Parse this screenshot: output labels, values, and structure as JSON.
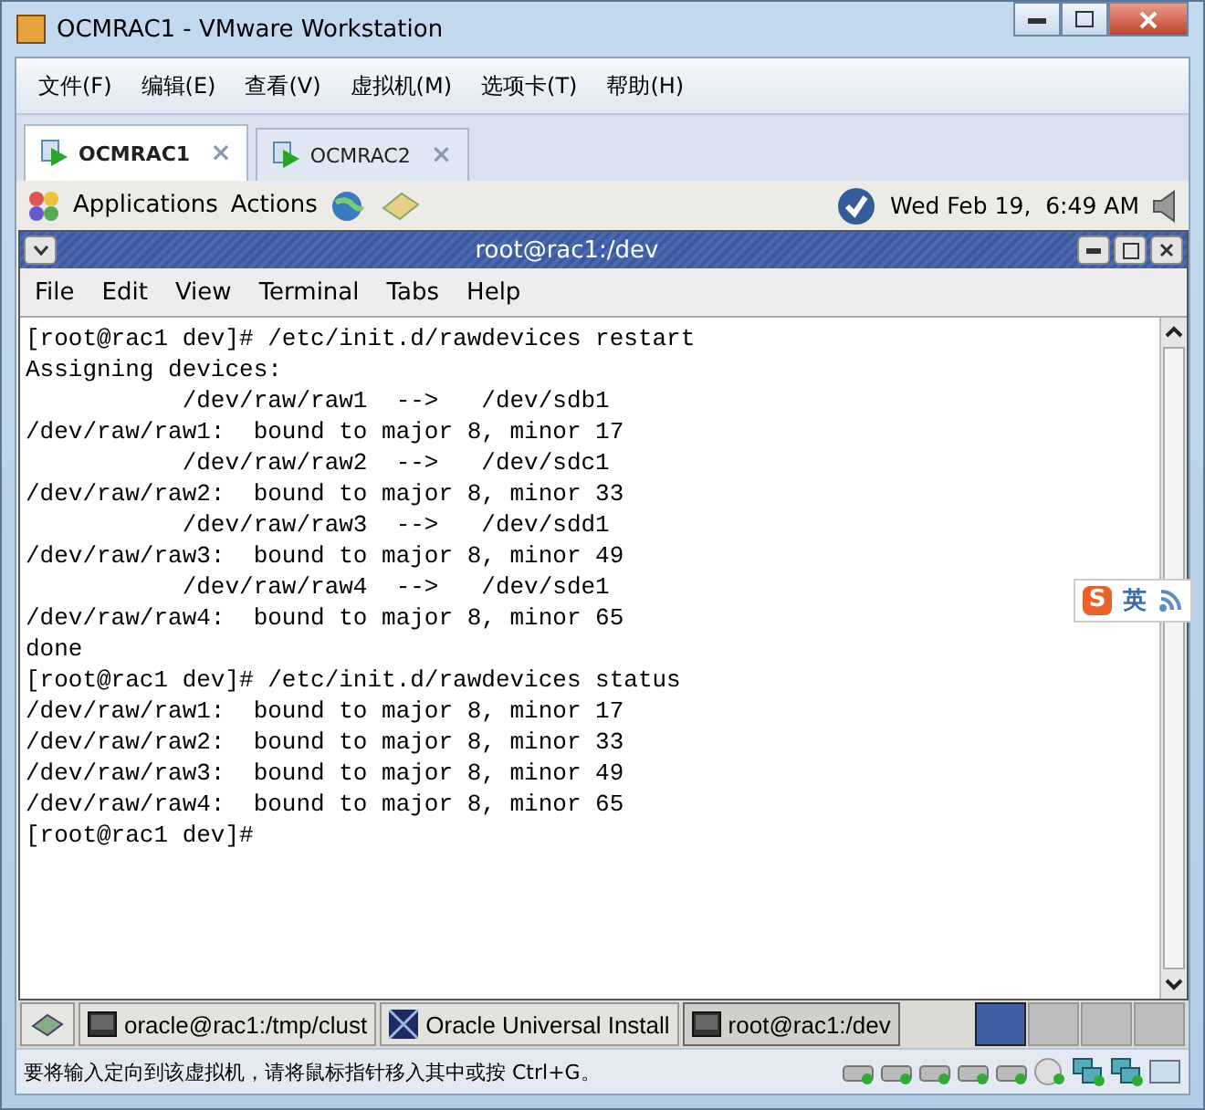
{
  "window": {
    "title": "OCMRAC1 - VMware Workstation"
  },
  "menu": [
    "文件(F)",
    "编辑(E)",
    "查看(V)",
    "虚拟机(M)",
    "选项卡(T)",
    "帮助(H)"
  ],
  "vm_tabs": [
    {
      "label": "OCMRAC1",
      "close": "×",
      "selected": true
    },
    {
      "label": "OCMRAC2",
      "close": "×",
      "selected": false
    }
  ],
  "panel": {
    "menus": [
      "Applications",
      "Actions"
    ],
    "clock": "Wed Feb 19,  6:49 AM"
  },
  "terminal": {
    "title": "root@rac1:/dev",
    "menu": [
      "File",
      "Edit",
      "View",
      "Terminal",
      "Tabs",
      "Help"
    ],
    "lines": [
      "[root@rac1 dev]# /etc/init.d/rawdevices restart",
      "Assigning devices:",
      "           /dev/raw/raw1  -->   /dev/sdb1",
      "/dev/raw/raw1:  bound to major 8, minor 17",
      "           /dev/raw/raw2  -->   /dev/sdc1",
      "/dev/raw/raw2:  bound to major 8, minor 33",
      "           /dev/raw/raw3  -->   /dev/sdd1",
      "/dev/raw/raw3:  bound to major 8, minor 49",
      "           /dev/raw/raw4  -->   /dev/sde1",
      "/dev/raw/raw4:  bound to major 8, minor 65",
      "done",
      "[root@rac1 dev]# /etc/init.d/rawdevices status",
      "/dev/raw/raw1:  bound to major 8, minor 17",
      "/dev/raw/raw2:  bound to major 8, minor 33",
      "/dev/raw/raw3:  bound to major 8, minor 49",
      "/dev/raw/raw4:  bound to major 8, minor 65",
      "[root@rac1 dev]#"
    ]
  },
  "taskbar": {
    "items": [
      {
        "label": "oracle@rac1:/tmp/clust",
        "kind": "terminal",
        "selected": false
      },
      {
        "label": "Oracle Universal Install",
        "kind": "installer",
        "selected": false
      },
      {
        "label": "root@rac1:/dev",
        "kind": "terminal",
        "selected": true
      }
    ],
    "workspaces": [
      {
        "selected": true
      },
      {
        "selected": false
      },
      {
        "selected": false
      },
      {
        "selected": false
      }
    ]
  },
  "ime": {
    "logo": "S",
    "mode": "英"
  },
  "status_bar": {
    "text": "要将输入定向到该虚拟机，请将鼠标指针移入其中或按 Ctrl+G。"
  }
}
